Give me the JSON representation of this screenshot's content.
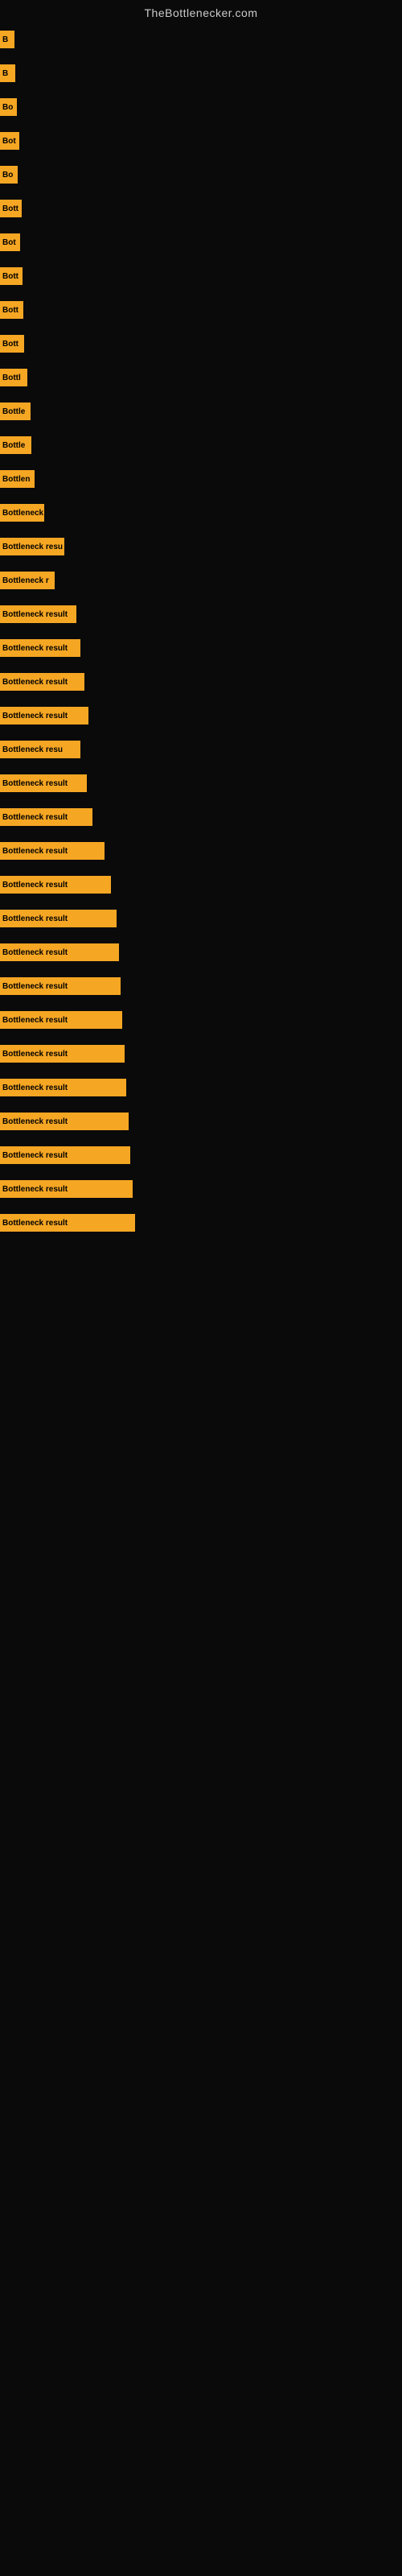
{
  "site": {
    "title": "TheBottlenecker.com"
  },
  "bars": [
    {
      "label": "B",
      "width": 18
    },
    {
      "label": "B",
      "width": 19
    },
    {
      "label": "Bo",
      "width": 21
    },
    {
      "label": "Bot",
      "width": 24
    },
    {
      "label": "Bo",
      "width": 22
    },
    {
      "label": "Bott",
      "width": 27
    },
    {
      "label": "Bot",
      "width": 25
    },
    {
      "label": "Bott",
      "width": 28
    },
    {
      "label": "Bott",
      "width": 29
    },
    {
      "label": "Bott",
      "width": 30
    },
    {
      "label": "Bottl",
      "width": 34
    },
    {
      "label": "Bottle",
      "width": 38
    },
    {
      "label": "Bottle",
      "width": 39
    },
    {
      "label": "Bottlen",
      "width": 43
    },
    {
      "label": "Bottleneck",
      "width": 55
    },
    {
      "label": "Bottleneck resu",
      "width": 80
    },
    {
      "label": "Bottleneck r",
      "width": 68
    },
    {
      "label": "Bottleneck result",
      "width": 95
    },
    {
      "label": "Bottleneck result",
      "width": 100
    },
    {
      "label": "Bottleneck result",
      "width": 105
    },
    {
      "label": "Bottleneck result",
      "width": 110
    },
    {
      "label": "Bottleneck resu",
      "width": 100
    },
    {
      "label": "Bottleneck result",
      "width": 108
    },
    {
      "label": "Bottleneck result",
      "width": 115
    },
    {
      "label": "Bottleneck result",
      "width": 130
    },
    {
      "label": "Bottleneck result",
      "width": 138
    },
    {
      "label": "Bottleneck result",
      "width": 145
    },
    {
      "label": "Bottleneck result",
      "width": 148
    },
    {
      "label": "Bottleneck result",
      "width": 150
    },
    {
      "label": "Bottleneck result",
      "width": 152
    },
    {
      "label": "Bottleneck result",
      "width": 155
    },
    {
      "label": "Bottleneck result",
      "width": 157
    },
    {
      "label": "Bottleneck result",
      "width": 160
    },
    {
      "label": "Bottleneck result",
      "width": 162
    },
    {
      "label": "Bottleneck result",
      "width": 165
    },
    {
      "label": "Bottleneck result",
      "width": 168
    }
  ]
}
